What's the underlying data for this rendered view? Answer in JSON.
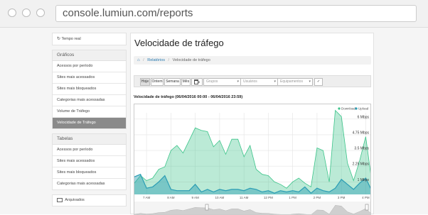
{
  "browser": {
    "url": "console.lumiun.com/reports"
  },
  "sidebar": {
    "realtime": "Tempo real",
    "graficos_title": "Gráficos",
    "graficos": [
      {
        "label": "Acessos por período",
        "active": false
      },
      {
        "label": "Sites mais acessados",
        "active": false
      },
      {
        "label": "Sites mais bloqueados",
        "active": false
      },
      {
        "label": "Categorias mais acessadas",
        "active": false
      },
      {
        "label": "Volume de Tráfego",
        "active": false
      },
      {
        "label": "Velocidade de Tráfego",
        "active": true
      }
    ],
    "tabelas_title": "Tabelas",
    "tabelas": [
      {
        "label": "Acessos por período"
      },
      {
        "label": "Sites mais acessados"
      },
      {
        "label": "Sites mais bloqueados"
      },
      {
        "label": "Categorias mais acessadas"
      }
    ],
    "archived": "Arquivados"
  },
  "main": {
    "title": "Velocidade de tráfego",
    "breadcrumb": {
      "home_icon": "home-icon",
      "section": "Relatórios",
      "current": "Velocidade de tráfego"
    },
    "toolbar": {
      "periods": [
        "Hoje",
        "Ontem",
        "Semana",
        "Mês"
      ],
      "active_period": "Hoje",
      "calendar_icon": "calendar-icon",
      "groups_placeholder": "Grupos",
      "users_placeholder": "Usuários",
      "devices_placeholder": "Equipamentos",
      "apply_icon": "check-icon"
    },
    "chart_title": "Velocidade de tráfego (06/04/2016 00:00 - 06/04/2016 23:59)"
  },
  "colors": {
    "download": "#3cc48a",
    "upload": "#2a9db4",
    "active_item": "#8a8a8a",
    "link": "#2a7ab0"
  },
  "chart_data": {
    "type": "area",
    "title": "Velocidade de tráfego (06/04/2016 00:00 - 06/04/2016 23:59)",
    "legend": [
      "Download",
      "Upload"
    ],
    "legend_position": "top-right",
    "x_ticks": [
      "7 AM",
      "8 AM",
      "9 AM",
      "10 AM",
      "11 AM",
      "12 PM",
      "1 PM",
      "2 PM",
      "3 PM",
      "4 PM"
    ],
    "y_ticks": [
      "1 Mbps",
      "2.25 Mbps",
      "3.5 Mbps",
      "4.75 Mbps",
      "6 Mbps"
    ],
    "ylim": [
      0,
      6.5
    ],
    "grid": true,
    "x_hours": [
      6.5,
      6.75,
      7,
      7.25,
      7.5,
      7.75,
      8,
      8.25,
      8.5,
      8.75,
      9,
      9.25,
      9.5,
      9.75,
      10,
      10.25,
      10.5,
      10.75,
      11,
      11.25,
      11.5,
      11.75,
      12,
      12.25,
      12.5,
      12.75,
      13,
      13.25,
      13.5,
      13.75,
      14,
      14.25,
      14.5,
      14.75,
      15,
      15.25,
      15.5,
      15.75,
      16,
      16.25
    ],
    "series": [
      {
        "name": "Download",
        "values": [
          0.9,
          1.5,
          1.1,
          1.3,
          2.0,
          2.2,
          3.5,
          3.9,
          3.3,
          4.3,
          5.3,
          5.1,
          5.0,
          3.8,
          4.3,
          3.2,
          4.4,
          4.4,
          3.0,
          3.9,
          2.0,
          1.6,
          1.5,
          1.0,
          0.8,
          0.5,
          1.0,
          1.3,
          0.9,
          0.6,
          3.7,
          3.5,
          1.0,
          6.7,
          6.2,
          2.5,
          1.1,
          2.7,
          4.6,
          1.0
        ]
      },
      {
        "name": "Upload",
        "values": [
          1.4,
          1.6,
          0.5,
          0.6,
          1.0,
          1.5,
          0.4,
          0.3,
          0.3,
          0.3,
          0.8,
          0.2,
          0.4,
          0.2,
          0.4,
          0.3,
          0.4,
          0.4,
          0.3,
          0.5,
          0.4,
          0.2,
          0.3,
          0.1,
          0.3,
          0.2,
          0.3,
          0.2,
          0.6,
          0.1,
          0.5,
          0.3,
          0.2,
          0.5,
          1.2,
          0.8,
          0.4,
          0.9,
          1.3,
          0.3
        ]
      }
    ]
  }
}
